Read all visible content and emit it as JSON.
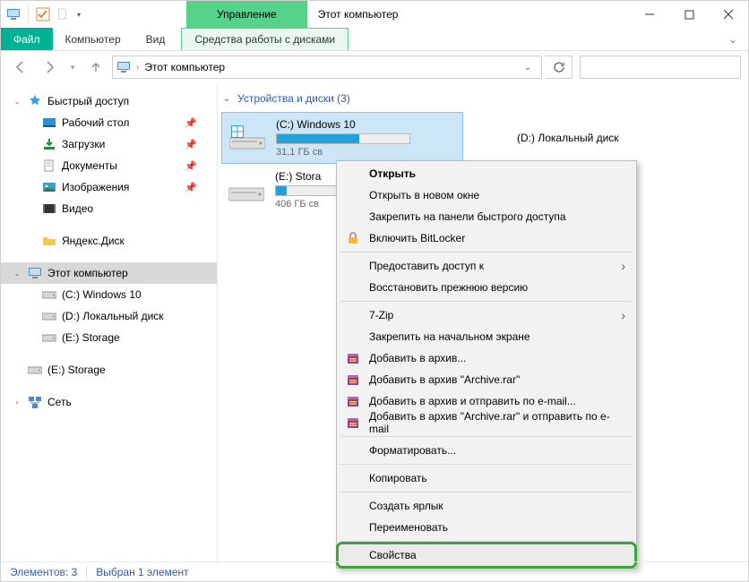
{
  "title": "Этот компьютер",
  "ribbon_context": "Управление",
  "tabs": {
    "file": "Файл",
    "computer": "Компьютер",
    "view": "Вид",
    "ctx": "Средства работы с дисками"
  },
  "address": {
    "crumb": "Этот компьютер"
  },
  "tree": {
    "quick": "Быстрый доступ",
    "desktop": "Рабочий стол",
    "downloads": "Загрузки",
    "documents": "Документы",
    "pictures": "Изображения",
    "video": "Видео",
    "yadisk": "Яндекс.Диск",
    "thispc": "Этот компьютер",
    "c": "(C:) Windows 10",
    "d": "(D:) Локальный диск",
    "e": "(E:) Storage",
    "e2": "(E:) Storage",
    "network": "Сеть"
  },
  "group": {
    "label": "Устройства и диски (3)"
  },
  "drives": {
    "c": {
      "name": "(C:) Windows 10",
      "free": "31,1 ГБ св",
      "fill": 62
    },
    "d": {
      "name": "(D:) Локальный диск"
    },
    "e": {
      "name": "(E:) Stora",
      "free": "406 ГБ св",
      "fill": 8
    }
  },
  "ctx": {
    "open": "Открыть",
    "open_new": "Открыть в новом окне",
    "pin_qa": "Закрепить на панели быстрого доступа",
    "bitlocker": "Включить BitLocker",
    "share": "Предоставить доступ к",
    "restore": "Восстановить прежнюю версию",
    "sevenzip": "7-Zip",
    "pin_start": "Закрепить на начальном экране",
    "rar_add": "Добавить в архив...",
    "rar_add_name": "Добавить в архив \"Archive.rar\"",
    "rar_mail": "Добавить в архив и отправить по e-mail...",
    "rar_mail_name": "Добавить в архив \"Archive.rar\" и отправить по e-mail",
    "format": "Форматировать...",
    "copy": "Копировать",
    "shortcut": "Создать ярлык",
    "rename": "Переименовать",
    "properties": "Свойства"
  },
  "status": {
    "count": "Элементов: 3",
    "selected": "Выбран 1 элемент"
  }
}
